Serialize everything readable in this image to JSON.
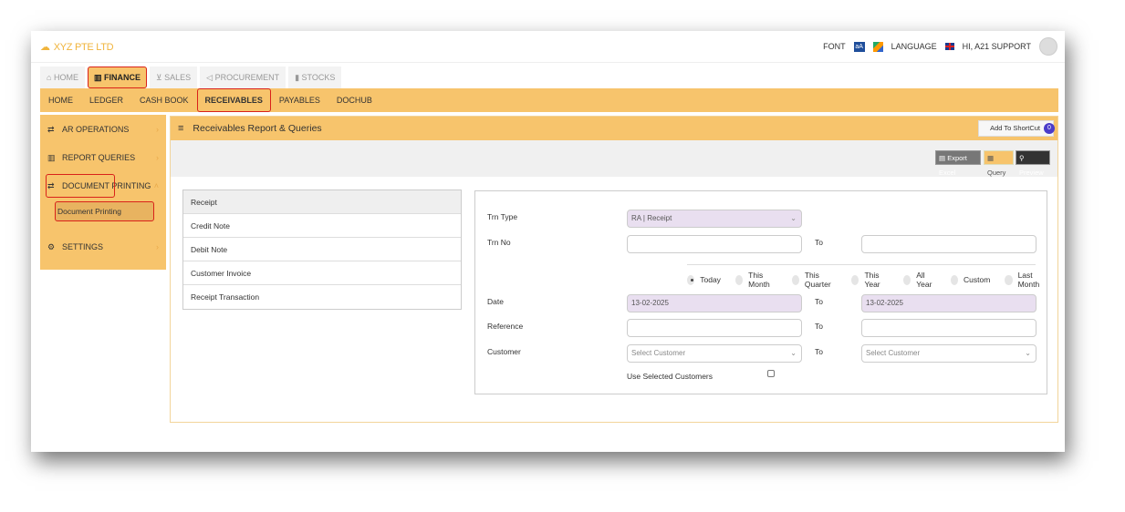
{
  "app": {
    "brand": "XYZ PTE LTD",
    "font_label": "FONT",
    "language_label": "LANGUAGE",
    "user_greeting": "HI, A21 SUPPORT"
  },
  "module_tabs": [
    {
      "label": "HOME",
      "icon": "home-icon",
      "glyph": "⌂"
    },
    {
      "label": "FINANCE",
      "icon": "bank-icon",
      "glyph": "🏛"
    },
    {
      "label": "SALES",
      "icon": "cart-icon",
      "glyph": "🛒"
    },
    {
      "label": "PROCUREMENT",
      "icon": "megaphone-icon",
      "glyph": "📢"
    },
    {
      "label": "STOCKS",
      "icon": "bar-chart-icon",
      "glyph": "▮"
    }
  ],
  "subnav": [
    "HOME",
    "LEDGER",
    "CASH BOOK",
    "RECEIVABLES",
    "PAYABLES",
    "DOCHUB"
  ],
  "sidebar": {
    "items": [
      {
        "label": "AR OPERATIONS"
      },
      {
        "label": "REPORT QUERIES"
      },
      {
        "label": "DOCUMENT PRINTING"
      },
      {
        "label": "SETTINGS"
      }
    ],
    "subitem": "Document Printing"
  },
  "panel": {
    "title": "Receivables Report & Queries",
    "shortcut_label": "Add To ShortCut",
    "shortcut_badge": "0",
    "export_label": "Export Excel",
    "query_label": "Query",
    "preview_label": "Preview"
  },
  "reports": [
    "Receipt",
    "Credit Note",
    "Debit Note",
    "Customer Invoice",
    "Receipt Transaction"
  ],
  "form": {
    "trn_type_label": "Trn Type",
    "trn_type_value": "RA | Receipt",
    "trn_no_label": "Trn No",
    "to_label": "To",
    "date_options": [
      "Today",
      "This Month",
      "This Quarter",
      "This Year",
      "All Year",
      "Custom",
      "Last Month"
    ],
    "date_label": "Date",
    "date_from": "13-02-2025",
    "date_to": "13-02-2025",
    "reference_label": "Reference",
    "customer_label": "Customer",
    "customer_placeholder": "Select Customer",
    "use_selected_label": "Use Selected Customers"
  }
}
